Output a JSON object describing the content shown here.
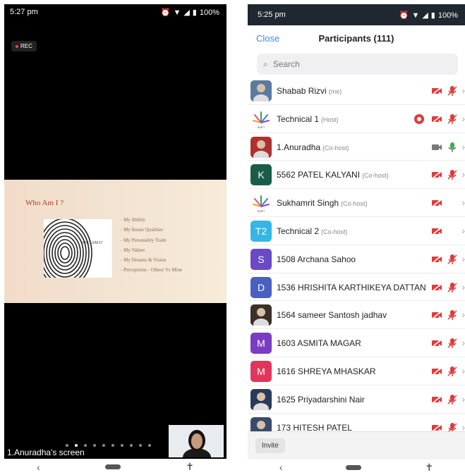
{
  "left": {
    "status_time": "5:27 pm",
    "status_battery": "100%",
    "rec_label": "REC",
    "slide": {
      "title": "Who Am I ?",
      "fingerprint_text": "WHO AM I?",
      "bullets": [
        "My Ability",
        "My Innate Qualities",
        "My Personality Traits",
        "My Values",
        "My Dreams & Vision",
        "Perceptions - Others Vs Mine"
      ]
    },
    "share_label": "1.Anuradha's screen",
    "pager_count": 10,
    "pager_active": 1
  },
  "right": {
    "status_time": "5:25 pm",
    "status_battery": "100%",
    "close_label": "Close",
    "title": "Participants (111)",
    "search_placeholder": "Search",
    "invite_label": "Invite",
    "participants": [
      {
        "name": "Shabab Rizvi",
        "role": "(me)",
        "avatar": "photo",
        "color": "#5a7aa0",
        "video": "off",
        "mic": "off",
        "rec": false
      },
      {
        "name": "Technical 1",
        "role": "(Host)",
        "avatar": "logo",
        "color": "#ffffff",
        "video": "off",
        "mic": "off",
        "rec": true
      },
      {
        "name": "1.Anuradha",
        "role": "(Co-host)",
        "avatar": "photo",
        "color": "#b03030",
        "video": "on",
        "mic": "on",
        "rec": false
      },
      {
        "name": "5562 PATEL KALYANI",
        "role": "(Co-host)",
        "avatar": "K",
        "color": "#1a5c4a",
        "video": "off",
        "mic": "off",
        "rec": false
      },
      {
        "name": "Sukhamrit Singh",
        "role": "(Co-host)",
        "avatar": "logo",
        "color": "#ffffff",
        "video": "off",
        "mic": "none",
        "rec": false
      },
      {
        "name": "Technical 2",
        "role": "(Co-host)",
        "avatar": "T2",
        "color": "#35b6e6",
        "video": "off",
        "mic": "none",
        "rec": false
      },
      {
        "name": "1508 Archana Sahoo",
        "role": "",
        "avatar": "S",
        "color": "#6a49c6",
        "video": "off",
        "mic": "off",
        "rec": false
      },
      {
        "name": "1536 HRISHITA KARTHIKEYA DATTAN",
        "role": "",
        "avatar": "D",
        "color": "#4a60c0",
        "video": "off",
        "mic": "off",
        "rec": false
      },
      {
        "name": "1564 sameer Santosh jadhav",
        "role": "",
        "avatar": "photo",
        "color": "#3a3026",
        "video": "off",
        "mic": "off",
        "rec": false
      },
      {
        "name": "1603 ASMITA MAGAR",
        "role": "",
        "avatar": "M",
        "color": "#7a3cc0",
        "video": "off",
        "mic": "off",
        "rec": false
      },
      {
        "name": "1616 SHREYA MHASKAR",
        "role": "",
        "avatar": "M",
        "color": "#e0365c",
        "video": "off",
        "mic": "off",
        "rec": false
      },
      {
        "name": "1625 Priyadarshini Nair",
        "role": "",
        "avatar": "photo",
        "color": "#2a3a5a",
        "video": "off",
        "mic": "off",
        "rec": false
      },
      {
        "name": "173 HITESH PATEL",
        "role": "",
        "avatar": "photo",
        "color": "#3a4a6a",
        "video": "off",
        "mic": "off",
        "rec": false
      }
    ]
  },
  "colors": {
    "accent": "#3d8be0",
    "muted_red": "#e03b3b",
    "active_green": "#3cb043"
  }
}
